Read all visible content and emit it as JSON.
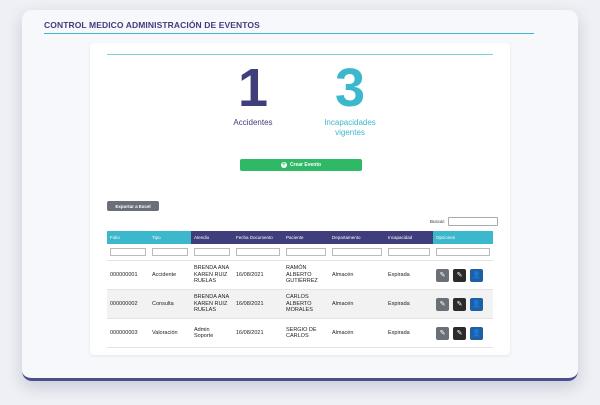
{
  "header": {
    "title": "CONTROL MEDICO ADMINISTRACIÓN DE EVENTOS"
  },
  "stats": [
    {
      "value": "1",
      "label": "Accidentes"
    },
    {
      "value": "3",
      "label": "Incapacidades vigentes"
    }
  ],
  "buttons": {
    "create": "Crear Evento",
    "export": "Exportar a Excel"
  },
  "search": {
    "label": "Buscar:",
    "value": ""
  },
  "table": {
    "columns": [
      "Folio",
      "Tipo",
      "Atendio",
      "Fecha Documento",
      "Paciente",
      "Departamento",
      "Incapacidad",
      "Opciones"
    ],
    "rows": [
      {
        "folio": "000000001",
        "tipo": "Accidente",
        "atendio": "BRENDA ANA KAREN RUIZ RUELAS",
        "fecha": "16/08/2021",
        "paciente": "RAMÓN ALBERTO GUTIÉRREZ",
        "departamento": "Almacén",
        "incapacidad": "Expirada"
      },
      {
        "folio": "000000002",
        "tipo": "Consulta",
        "atendio": "BRENDA ANA KAREN RUIZ RUELAS",
        "fecha": "16/08/2021",
        "paciente": "CARLOS ALBERTO MORALES",
        "departamento": "Almacén",
        "incapacidad": "Expirada"
      },
      {
        "folio": "000000003",
        "tipo": "Valoración",
        "atendio": "Admin Soporte",
        "fecha": "16/08/2021",
        "paciente": "SERGIO DE CARLOS",
        "departamento": "Almacén",
        "incapacidad": "Expirada"
      }
    ]
  },
  "icons": {
    "edit": "pencil-icon",
    "edit_alt": "pencil-icon",
    "user": "user-icon",
    "add": "plus-circle-icon"
  },
  "colors": {
    "primary": "#3f3d7c",
    "accent": "#3bb8cc",
    "success": "#2fb865",
    "secondary": "#6b7078",
    "action_user": "#1f5fa3"
  }
}
